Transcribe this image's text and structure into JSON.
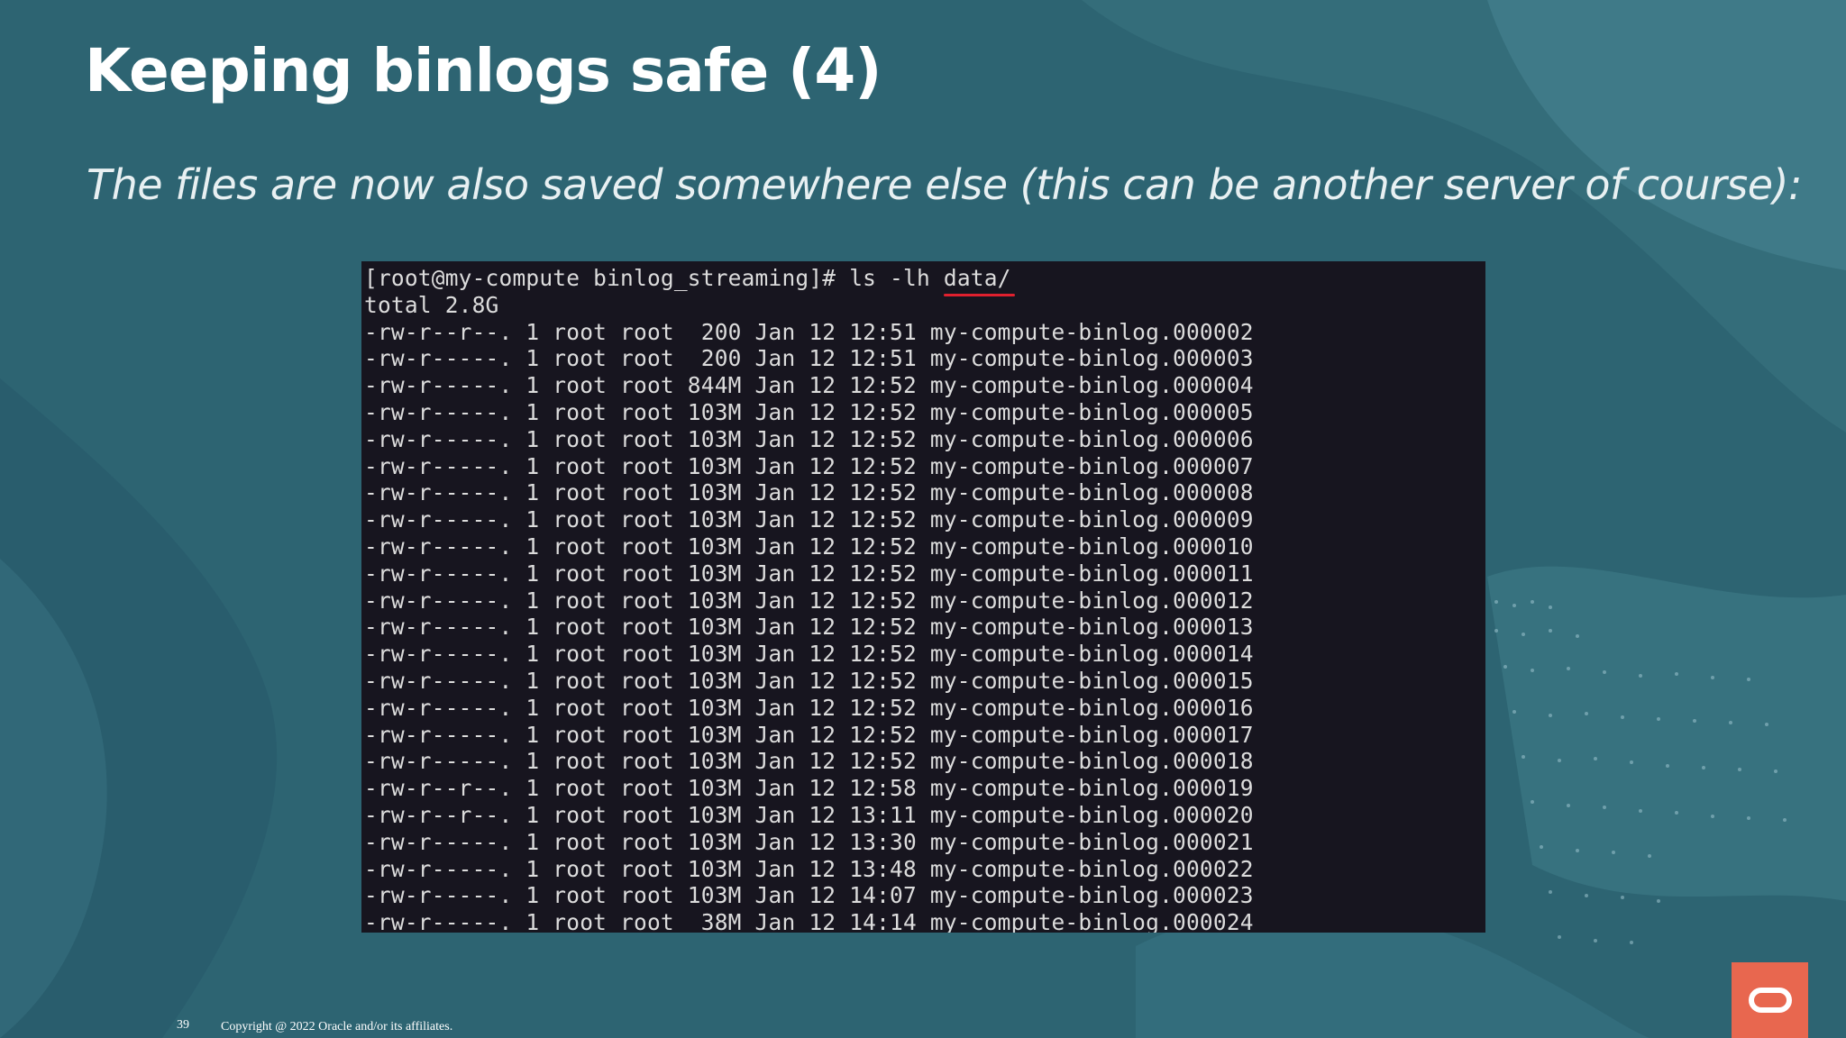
{
  "slide": {
    "title": "Keeping binlogs safe (4)",
    "subtitle": "The files are now also saved somewhere else (this can be another server of course):",
    "page_number": "39",
    "copyright": "Copyright @ 2022 Oracle and/or its affiliates.",
    "brand_color": "#e8674f",
    "background_color": "#2d6472"
  },
  "terminal": {
    "prompt": "[root@my-compute binlog_streaming]# ls -lh ",
    "prompt_arg": "data/",
    "total": "total 2.8G",
    "lines": [
      "-rw-r--r--. 1 root root  200 Jan 12 12:51 my-compute-binlog.000002",
      "-rw-r-----. 1 root root  200 Jan 12 12:51 my-compute-binlog.000003",
      "-rw-r-----. 1 root root 844M Jan 12 12:52 my-compute-binlog.000004",
      "-rw-r-----. 1 root root 103M Jan 12 12:52 my-compute-binlog.000005",
      "-rw-r-----. 1 root root 103M Jan 12 12:52 my-compute-binlog.000006",
      "-rw-r-----. 1 root root 103M Jan 12 12:52 my-compute-binlog.000007",
      "-rw-r-----. 1 root root 103M Jan 12 12:52 my-compute-binlog.000008",
      "-rw-r-----. 1 root root 103M Jan 12 12:52 my-compute-binlog.000009",
      "-rw-r-----. 1 root root 103M Jan 12 12:52 my-compute-binlog.000010",
      "-rw-r-----. 1 root root 103M Jan 12 12:52 my-compute-binlog.000011",
      "-rw-r-----. 1 root root 103M Jan 12 12:52 my-compute-binlog.000012",
      "-rw-r-----. 1 root root 103M Jan 12 12:52 my-compute-binlog.000013",
      "-rw-r-----. 1 root root 103M Jan 12 12:52 my-compute-binlog.000014",
      "-rw-r-----. 1 root root 103M Jan 12 12:52 my-compute-binlog.000015",
      "-rw-r-----. 1 root root 103M Jan 12 12:52 my-compute-binlog.000016",
      "-rw-r-----. 1 root root 103M Jan 12 12:52 my-compute-binlog.000017",
      "-rw-r-----. 1 root root 103M Jan 12 12:52 my-compute-binlog.000018",
      "-rw-r--r--. 1 root root 103M Jan 12 12:58 my-compute-binlog.000019",
      "-rw-r--r--. 1 root root 103M Jan 12 13:11 my-compute-binlog.000020",
      "-rw-r-----. 1 root root 103M Jan 12 13:30 my-compute-binlog.000021",
      "-rw-r-----. 1 root root 103M Jan 12 13:48 my-compute-binlog.000022",
      "-rw-r-----. 1 root root 103M Jan 12 14:07 my-compute-binlog.000023",
      "-rw-r-----. 1 root root  38M Jan 12 14:14 my-compute-binlog.000024"
    ],
    "underline_color": "#e0202e"
  },
  "icons": {
    "brand": "oracle-logo-icon"
  }
}
